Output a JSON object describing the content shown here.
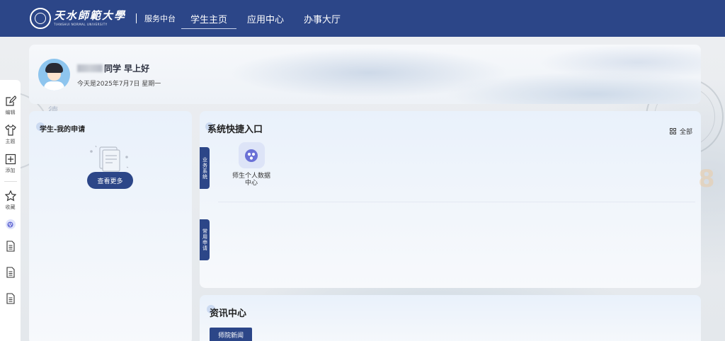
{
  "topbar": {
    "logo_cn": "天水師範大學",
    "logo_en": "TIANSHUI NORMAL UNIVERSITY",
    "platform": "服务中台",
    "nav": [
      {
        "label": "学生主页",
        "active": true
      },
      {
        "label": "应用中心",
        "active": false
      },
      {
        "label": "办事大厅",
        "active": false
      }
    ]
  },
  "rail": {
    "items": [
      {
        "label": "编辑",
        "icon": "edit-icon"
      },
      {
        "label": "主题",
        "icon": "shirt-icon"
      },
      {
        "label": "添加",
        "icon": "add-box-icon"
      },
      {
        "label": "收藏",
        "icon": "star-icon"
      }
    ]
  },
  "greeting": {
    "suffix": "同学 早上好",
    "date": "今天是2025年7月7日 星期一"
  },
  "apply_panel": {
    "title": "学生-我的申请",
    "more_button": "查看更多"
  },
  "quick_panel": {
    "title": "系统快捷入口",
    "all_label": "全部",
    "side_tabs": [
      "业务系统",
      "常用申请"
    ],
    "apps": [
      {
        "name": "师生个人数据中心",
        "icon": "data-center-icon"
      }
    ]
  },
  "news_panel": {
    "title": "资讯中心",
    "tabs": [
      "师院新闻"
    ]
  },
  "colors": {
    "primary": "#2c4688",
    "panel_bg": "#eef4fb",
    "accent_light": "#dde4f7"
  }
}
